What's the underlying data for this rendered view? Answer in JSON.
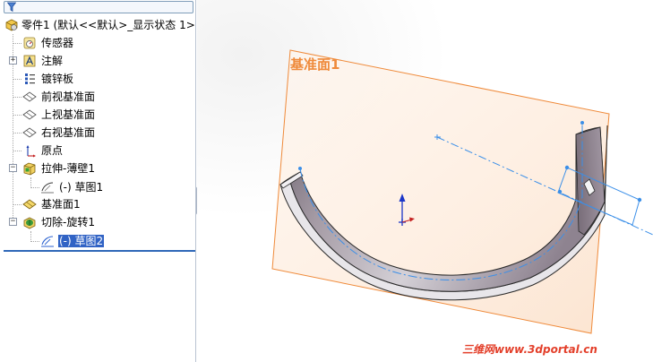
{
  "tree": {
    "items": [
      {
        "label": "零件1 (默认<<默认>_显示状态 1>",
        "icon": "part-icon"
      },
      {
        "label": "传感器",
        "icon": "sensor-icon"
      },
      {
        "label": "注解",
        "icon": "annotation-icon"
      },
      {
        "label": "镀锌板",
        "icon": "material-icon"
      },
      {
        "label": "前视基准面",
        "icon": "plane-icon"
      },
      {
        "label": "上视基准面",
        "icon": "plane-icon"
      },
      {
        "label": "右视基准面",
        "icon": "plane-icon"
      },
      {
        "label": "原点",
        "icon": "origin-icon"
      },
      {
        "label": "拉伸-薄壁1",
        "icon": "extrude-icon"
      },
      {
        "label": "(-) 草图1",
        "icon": "sketch-icon"
      },
      {
        "label": "基准面1",
        "icon": "plane-icon"
      },
      {
        "label": "切除-旋转1",
        "icon": "revolve-cut-icon"
      },
      {
        "label": "(-) 草图2",
        "icon": "sketch-icon"
      }
    ],
    "selected_index": 12
  },
  "viewport": {
    "plane_label": "基准面1",
    "watermark": "三维网www.3dportal.cn"
  },
  "colors": {
    "plane": "#ef8a3a",
    "sketch": "#3b8fe8",
    "selection": "#3163c5",
    "watermark": "#e33f2a"
  }
}
